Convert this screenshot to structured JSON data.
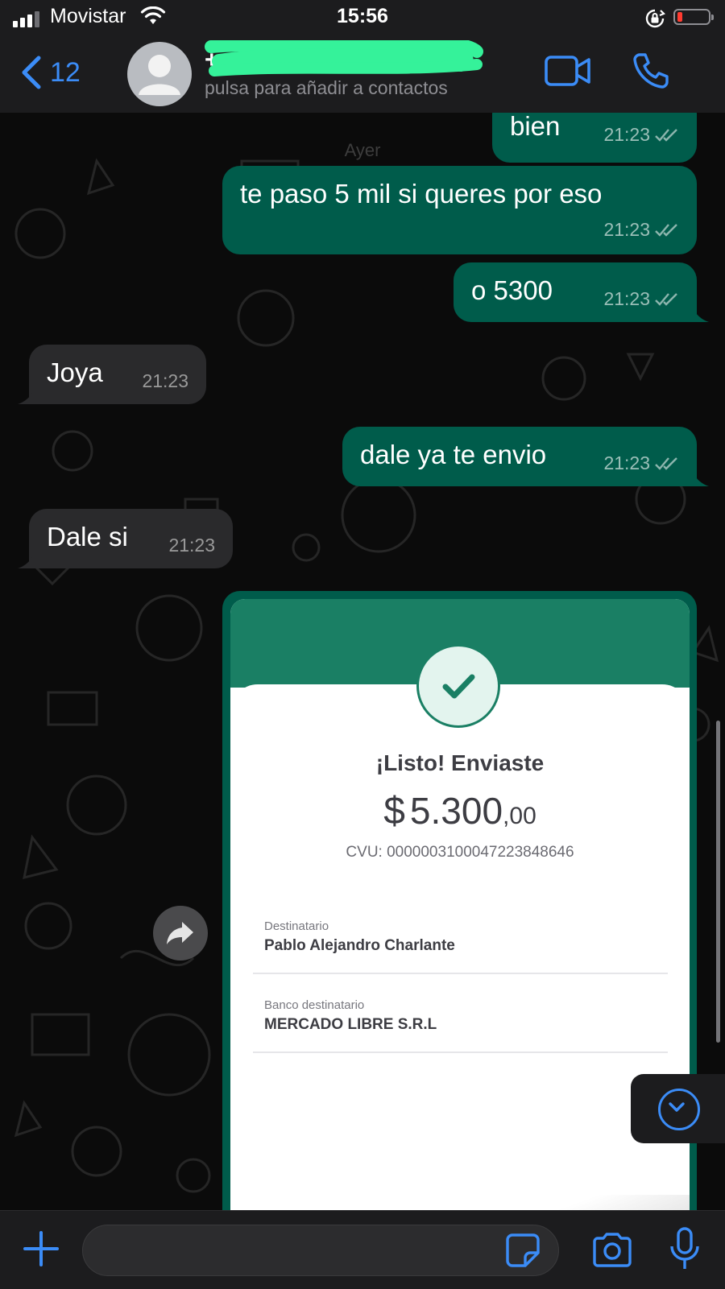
{
  "status_bar": {
    "carrier": "Movistar",
    "time": "15:56",
    "battery_color": "#ff3b30",
    "icons": [
      "signal-icon",
      "wifi-icon",
      "rotation-lock-icon",
      "battery-icon"
    ]
  },
  "header": {
    "back_count": "12",
    "contact_name": "+",
    "contact_subtitle": "pulsa para añadir a contactos",
    "icons": [
      "chevron-left-icon",
      "avatar-placeholder-icon",
      "video-camera-icon",
      "phone-icon"
    ],
    "accent_color": "#3b8cf7"
  },
  "chat": {
    "date_separator": "Ayer",
    "messages": [
      {
        "direction": "out",
        "text": "bien",
        "time": "21:23",
        "status": "read"
      },
      {
        "direction": "out",
        "text": "te paso 5 mil si queres por eso",
        "time": "21:23",
        "status": "read"
      },
      {
        "direction": "out",
        "text": "o 5300",
        "time": "21:23",
        "status": "read"
      },
      {
        "direction": "in",
        "text": "Joya",
        "time": "21:23"
      },
      {
        "direction": "out",
        "text": "dale ya te envio",
        "time": "21:23",
        "status": "read"
      },
      {
        "direction": "in",
        "text": "Dale si",
        "time": "21:23"
      }
    ],
    "outgoing_color": "#005c4b",
    "incoming_color": "#2a2a2c"
  },
  "receipt": {
    "title": "¡Listo! Enviaste",
    "currency": "$",
    "amount_int": "5.300",
    "amount_dec": ",00",
    "cvu": "CVU: 0000003100047223848646",
    "recipient_label": "Destinatario",
    "recipient_name": "Pablo Alejandro Charlante",
    "bank_label": "Banco destinatario",
    "bank_name": "MERCADO LIBRE S.R.L",
    "brand_color": "#1a7f64"
  },
  "input_bar": {
    "message_value": "",
    "icons": [
      "plus-icon",
      "sticker-icon",
      "camera-icon",
      "microphone-icon"
    ]
  },
  "floating": {
    "icons": [
      "forward-icon",
      "scroll-down-icon"
    ]
  }
}
